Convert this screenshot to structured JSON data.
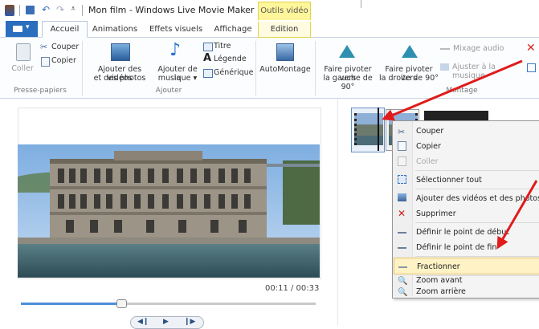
{
  "window": {
    "title": "Mon film - Windows Live Movie Maker",
    "contextual_tab_group": "Outils vidéo"
  },
  "tabs": [
    "Accueil",
    "Animations",
    "Effets visuels",
    "Affichage",
    "Edition"
  ],
  "ribbon": {
    "clipboard": {
      "paste": "Coller",
      "cut": "Couper",
      "copy": "Copier",
      "group": "Presse-papiers"
    },
    "add": {
      "add_videos_line1": "Ajouter des vidéos",
      "add_videos_line2": "et des photos",
      "add_music_line1": "Ajouter de la",
      "add_music_line2": "musique ▾",
      "title": "Titre",
      "caption": "Légende",
      "credits": "Générique",
      "group": "Ajouter"
    },
    "automovie": "AutoMontage",
    "rotate_left_line1": "Faire pivoter vers",
    "rotate_left_line2": "la gauche de 90°",
    "rotate_right_line1": "Faire pivoter vers",
    "rotate_right_line2": "la droite de 90°",
    "audio_mix": "Mixage audio",
    "fit_music": "Ajuster à la musique",
    "group_edit": "Montage"
  },
  "player": {
    "time": "00:11 / 00:33",
    "progress": 0.34
  },
  "context_menu": {
    "items": [
      {
        "label": "Couper",
        "icon": "scissors-icon"
      },
      {
        "label": "Copier",
        "icon": "copy-icon"
      },
      {
        "label": "Coller",
        "icon": "paste-icon",
        "disabled": true
      },
      {
        "label": "Sélectionner tout",
        "icon": "select-all-icon"
      },
      {
        "label": "Ajouter des vidéos et des photos",
        "icon": "add-media-icon"
      },
      {
        "label": "Supprimer",
        "icon": "delete-icon"
      },
      {
        "label": "Définir le point de début",
        "icon": "set-start-icon"
      },
      {
        "label": "Définir le point de fin",
        "icon": "set-end-icon"
      },
      {
        "label": "Fractionner",
        "icon": "split-icon",
        "highlighted": true
      },
      {
        "label": "Zoom avant",
        "icon": "zoom-in-icon"
      },
      {
        "label": "Zoom arrière",
        "icon": "zoom-out-icon"
      }
    ]
  },
  "colors": {
    "accent": "#2a6ebd",
    "annotation_arrow": "#e01b1b",
    "highlight": "#fff3c6",
    "contextual_tab": "#fff59a"
  }
}
